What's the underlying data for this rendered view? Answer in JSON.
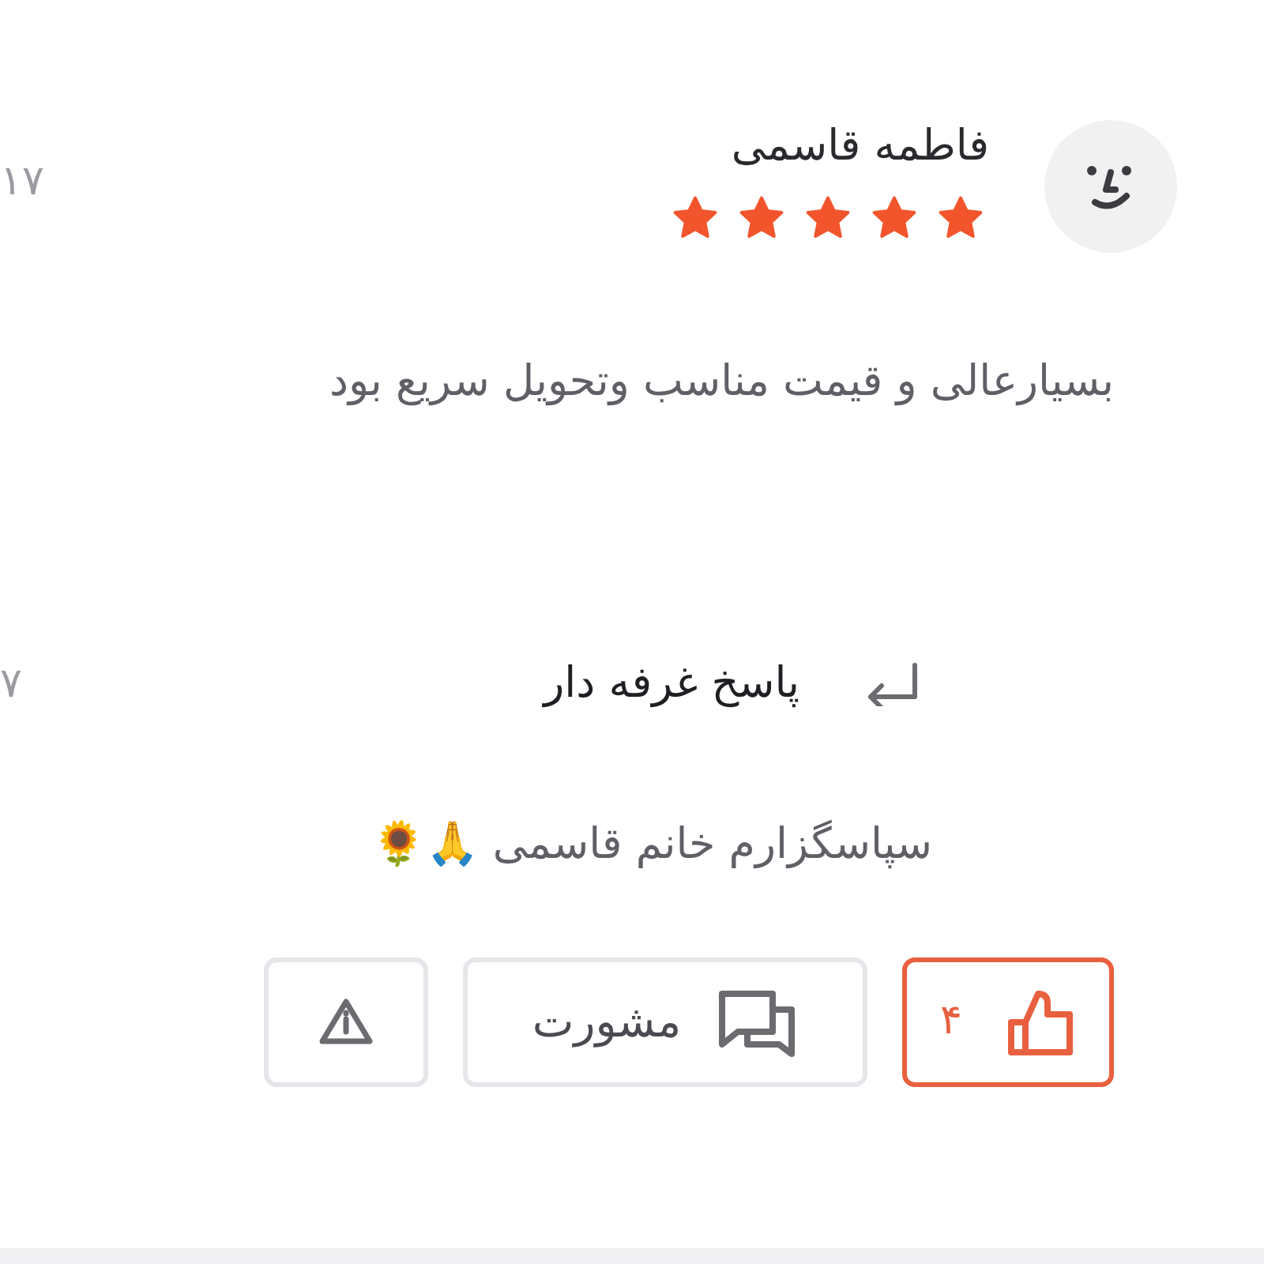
{
  "review": {
    "date": "۱۷",
    "author": "فاطمه قاسمی",
    "stars": 5,
    "comment": "بسیارعالی و قیمت مناسب وتحویل سریع بود"
  },
  "reply": {
    "date": "۷",
    "title": "پاسخ غرفه دار",
    "text": "سپاسگزارم  خانم قاسمی 🙏🌻"
  },
  "actions": {
    "likes": "۴",
    "liked": true,
    "comment_label": "مشورت"
  }
}
